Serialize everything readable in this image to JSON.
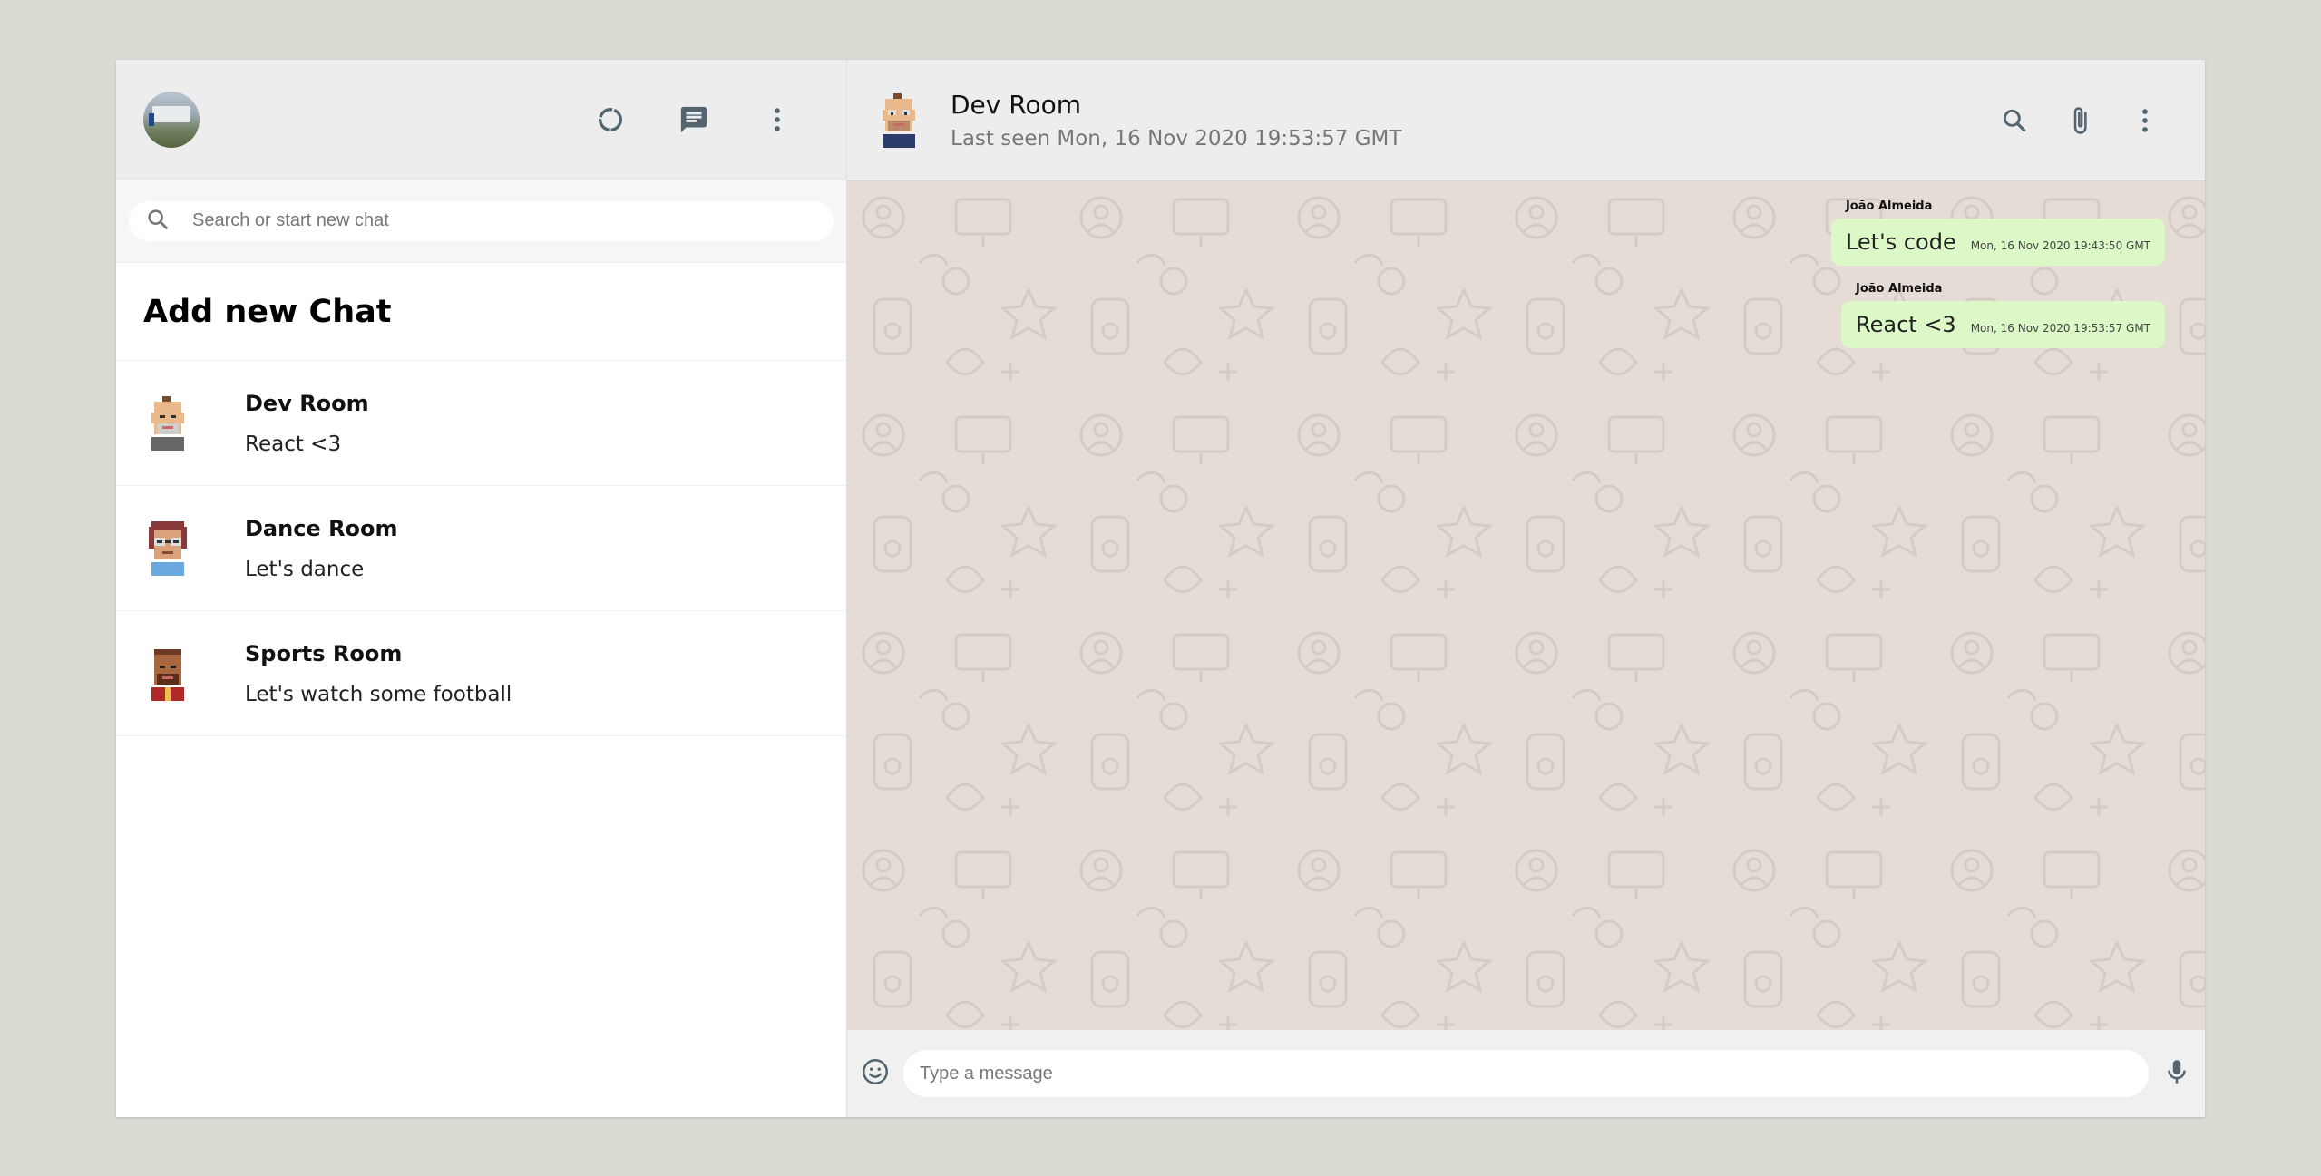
{
  "sidebar": {
    "search": {
      "placeholder": "Search or start new chat"
    },
    "add_chat_label": "Add new Chat",
    "chats": [
      {
        "name": "Dev Room",
        "last_message": "React <3",
        "avatar": "pixel-avatar-bald-beard"
      },
      {
        "name": "Dance Room",
        "last_message": "Let's dance",
        "avatar": "pixel-avatar-glasses"
      },
      {
        "name": "Sports Room",
        "last_message": "Let's watch some football",
        "avatar": "pixel-avatar-dark"
      }
    ]
  },
  "header_icons": [
    "status-icon",
    "new-chat-icon",
    "menu-icon"
  ],
  "chat": {
    "name": "Dev Room",
    "last_seen": "Last seen Mon, 16 Nov 2020 19:53:57 GMT",
    "icons": [
      "search-icon",
      "attach-icon",
      "menu-icon"
    ],
    "messages": [
      {
        "sender": "João Almeida",
        "text": "Let's code",
        "time": "Mon, 16 Nov 2020 19:43:50 GMT"
      },
      {
        "sender": "João Almeida",
        "text": "React <3",
        "time": "Mon, 16 Nov 2020 19:53:57 GMT"
      }
    ],
    "input": {
      "placeholder": "Type a message"
    }
  },
  "colors": {
    "page_background": "#dadbd3",
    "header_background": "#ededed",
    "chat_background": "#e5ddd5",
    "outgoing_bubble": "#dcf8c6",
    "icon_gray": "#54656f"
  }
}
